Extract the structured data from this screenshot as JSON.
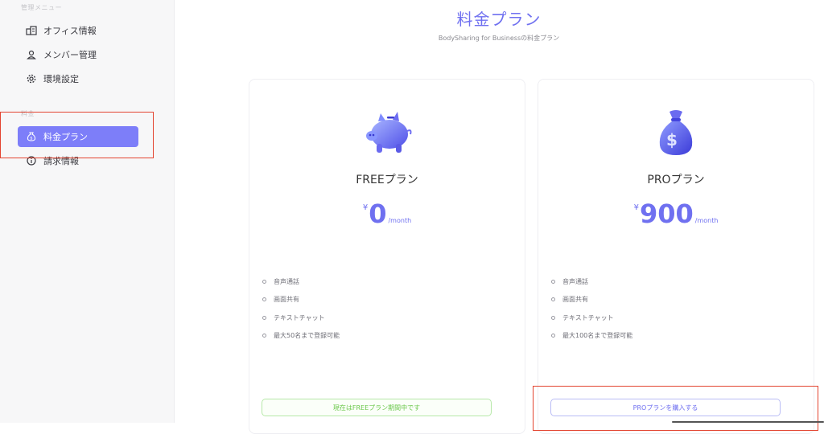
{
  "sidebar": {
    "section_manage": "管理メニュー",
    "section_fee": "料金",
    "items": [
      {
        "label": "オフィス情報",
        "icon": "office-icon"
      },
      {
        "label": "メンバー管理",
        "icon": "user-icon"
      },
      {
        "label": "環境設定",
        "icon": "gear-icon"
      },
      {
        "label": "料金プラン",
        "icon": "money-bag-icon",
        "active": true
      },
      {
        "label": "請求情報",
        "icon": "info-icon"
      }
    ]
  },
  "page": {
    "title": "料金プラン",
    "subtitle": "BodySharing for Businessの料金プラン"
  },
  "plans": [
    {
      "name": "FREEプラン",
      "icon": "piggy-bank-icon",
      "currency": "¥",
      "price": "0",
      "unit": "/month",
      "features": [
        "音声通話",
        "画面共有",
        "テキストチャット",
        "最大50名まで登録可能"
      ],
      "button": "現在はFREEプラン期間中です"
    },
    {
      "name": "PROプラン",
      "icon": "dollar-bag-icon",
      "currency": "¥",
      "price": "900",
      "unit": "/month",
      "features": [
        "音声通話",
        "画面共有",
        "テキストチャット",
        "最大100名まで登録可能"
      ],
      "button": "PROプランを購入する"
    }
  ],
  "colors": {
    "accent": "#7d7ef9",
    "highlight_box": "#e3432f",
    "free_button": "#6cc84d"
  }
}
